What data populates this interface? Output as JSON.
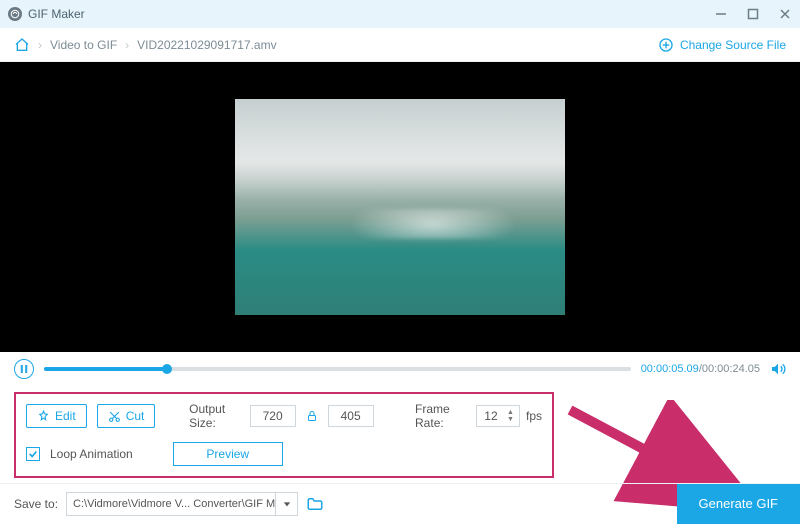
{
  "titlebar": {
    "app_name": "GIF Maker"
  },
  "breadcrumb": {
    "level1": "Video to GIF",
    "level2": "VID20221029091717.amv",
    "change_source": "Change Source File"
  },
  "player": {
    "current_time": "00:00:05.09",
    "total_time": "00:00:24.05",
    "progress_percent": 21
  },
  "settings": {
    "edit_label": "Edit",
    "cut_label": "Cut",
    "output_size_label": "Output Size:",
    "width": "720",
    "height": "405",
    "frame_rate_label": "Frame Rate:",
    "frame_rate": "12",
    "fps_label": "fps",
    "loop_label": "Loop Animation",
    "preview_label": "Preview"
  },
  "footer": {
    "save_to_label": "Save to:",
    "path": "C:\\Vidmore\\Vidmore V... Converter\\GIF Maker",
    "generate_label": "Generate GIF"
  }
}
